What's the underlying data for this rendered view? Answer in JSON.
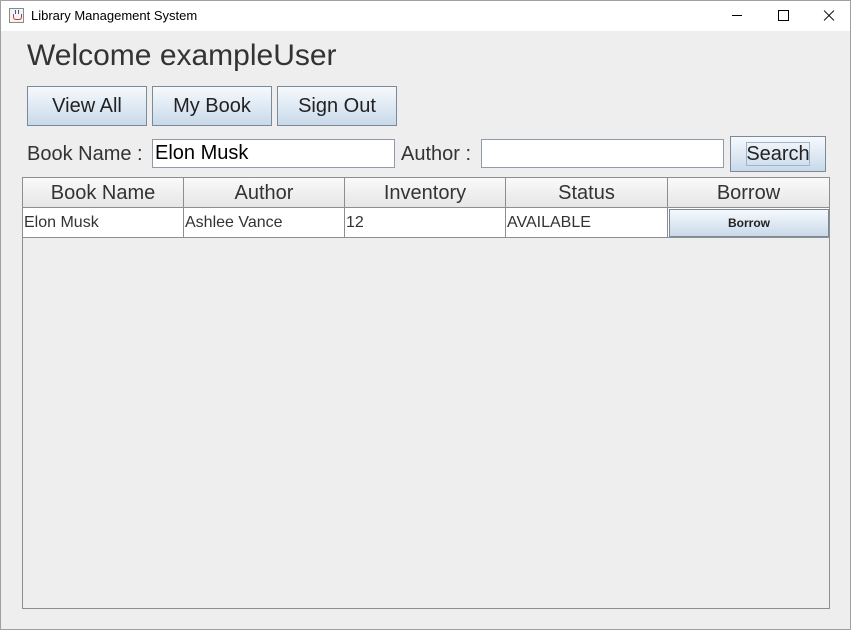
{
  "window": {
    "title": "Library Management System",
    "icon": "java-cup-icon",
    "controls": [
      "minimize-icon",
      "maximize-icon",
      "close-icon"
    ]
  },
  "header": {
    "welcome": "Welcome exampleUser"
  },
  "nav": {
    "view_all": "View All",
    "my_book": "My Book",
    "sign_out": "Sign Out"
  },
  "search": {
    "book_name_label": "Book Name :",
    "book_name_value": "Elon Musk",
    "author_label": "Author :",
    "author_value": "",
    "button": "Search"
  },
  "table": {
    "columns": [
      "Book Name",
      "Author",
      "Inventory",
      "Status",
      "Borrow"
    ],
    "rows": [
      {
        "book_name": "Elon Musk",
        "author": "Ashlee Vance",
        "inventory": "12",
        "status": "AVAILABLE",
        "action": "Borrow"
      }
    ]
  },
  "colors": {
    "window_bg": "#eeeeee",
    "button_gradient_top": "#f6f9fc",
    "button_gradient_bottom": "#c9d9e9",
    "button_border": "#7a8a99",
    "grid_line": "#8e8e8e"
  }
}
